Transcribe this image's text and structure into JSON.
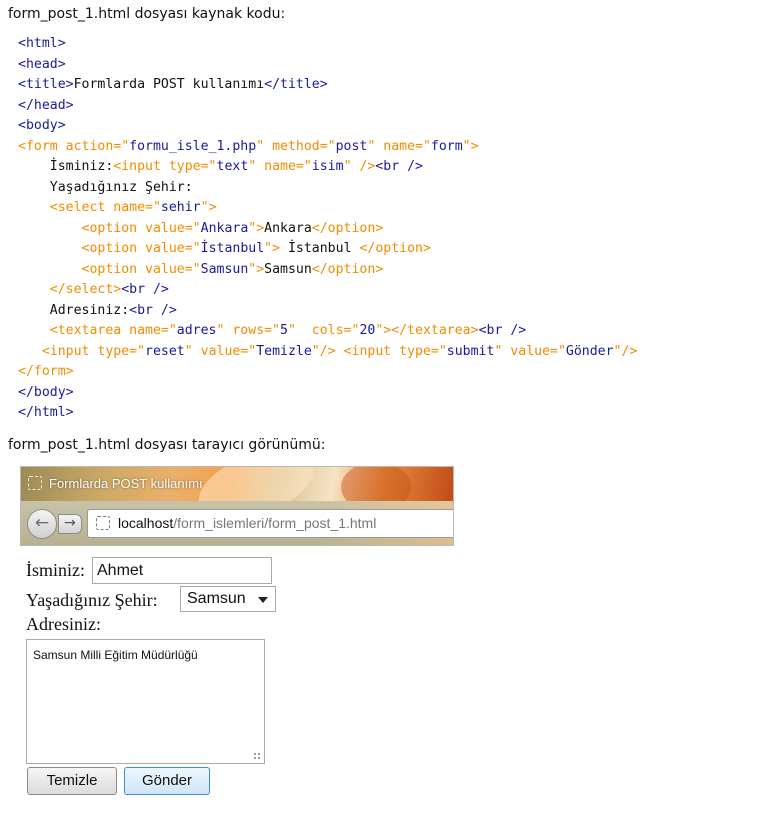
{
  "headings": {
    "source": "form_post_1.html dosyası kaynak kodu:",
    "browser": "form_post_1.html dosyası tarayıcı görünümü:"
  },
  "code_lines": [
    [
      {
        "t": "<html>",
        "c": "tagb"
      }
    ],
    [
      {
        "t": "<head>",
        "c": "tagb"
      }
    ],
    [
      {
        "t": "<title>",
        "c": "tagb"
      },
      {
        "t": "Formlarda POST kullanımı",
        "c": "txt"
      },
      {
        "t": "</title>",
        "c": "tagb"
      }
    ],
    [
      {
        "t": "</head>",
        "c": "tagb"
      }
    ],
    [
      {
        "t": "<body>",
        "c": "tagb"
      }
    ],
    [
      {
        "t": "<form action=\"",
        "c": "tago"
      },
      {
        "t": "formu_isle_1.php",
        "c": "val"
      },
      {
        "t": "\" method=\"",
        "c": "tago"
      },
      {
        "t": "post",
        "c": "val"
      },
      {
        "t": "\" name=\"",
        "c": "tago"
      },
      {
        "t": "form",
        "c": "val"
      },
      {
        "t": "\">",
        "c": "tago"
      }
    ],
    [
      {
        "t": "    İsminiz:",
        "c": "txt"
      },
      {
        "t": "<input type=\"",
        "c": "tago"
      },
      {
        "t": "text",
        "c": "val"
      },
      {
        "t": "\" name=\"",
        "c": "tago"
      },
      {
        "t": "isim",
        "c": "val"
      },
      {
        "t": "\" />",
        "c": "tago"
      },
      {
        "t": "<br />",
        "c": "tagb"
      }
    ],
    [
      {
        "t": "    Yaşadığınız Şehir:",
        "c": "txt"
      }
    ],
    [
      {
        "t": "    <select name=\"",
        "c": "tago"
      },
      {
        "t": "sehir",
        "c": "val"
      },
      {
        "t": "\">",
        "c": "tago"
      }
    ],
    [
      {
        "t": "        <option value=\"",
        "c": "tago"
      },
      {
        "t": "Ankara",
        "c": "val"
      },
      {
        "t": "\">",
        "c": "tago"
      },
      {
        "t": "Ankara",
        "c": "txt"
      },
      {
        "t": "</option>",
        "c": "tago"
      }
    ],
    [
      {
        "t": "        <option value=\"",
        "c": "tago"
      },
      {
        "t": "İstanbul",
        "c": "val"
      },
      {
        "t": "\">",
        "c": "tago"
      },
      {
        "t": " İstanbul ",
        "c": "txt"
      },
      {
        "t": "</option>",
        "c": "tago"
      }
    ],
    [
      {
        "t": "        <option value=\"",
        "c": "tago"
      },
      {
        "t": "Samsun",
        "c": "val"
      },
      {
        "t": "\">",
        "c": "tago"
      },
      {
        "t": "Samsun",
        "c": "txt"
      },
      {
        "t": "</option>",
        "c": "tago"
      }
    ],
    [
      {
        "t": "    </select>",
        "c": "tago"
      },
      {
        "t": "<br />",
        "c": "tagb"
      }
    ],
    [
      {
        "t": "    Adresiniz:",
        "c": "txt"
      },
      {
        "t": "<br />",
        "c": "tagb"
      }
    ],
    [
      {
        "t": "    <textarea name=\"",
        "c": "tago"
      },
      {
        "t": "adres",
        "c": "val"
      },
      {
        "t": "\" rows=\"",
        "c": "tago"
      },
      {
        "t": "5",
        "c": "val"
      },
      {
        "t": "\"  cols=\"",
        "c": "tago"
      },
      {
        "t": "20",
        "c": "val"
      },
      {
        "t": "\"></textarea>",
        "c": "tago"
      },
      {
        "t": "<br />",
        "c": "tagb"
      }
    ],
    [
      {
        "t": "   <input type=\"",
        "c": "tago"
      },
      {
        "t": "reset",
        "c": "val"
      },
      {
        "t": "\" value=\"",
        "c": "tago"
      },
      {
        "t": "Temizle",
        "c": "val"
      },
      {
        "t": "\"/>",
        "c": "tago"
      },
      {
        "t": " ",
        "c": "txt"
      },
      {
        "t": "<input type=\"",
        "c": "tago"
      },
      {
        "t": "submit",
        "c": "val"
      },
      {
        "t": "\" value=\"",
        "c": "tago"
      },
      {
        "t": "Gönder",
        "c": "val"
      },
      {
        "t": "\"/>",
        "c": "tago"
      }
    ],
    [
      {
        "t": "</form>",
        "c": "tago"
      }
    ],
    [
      {
        "t": "</body>",
        "c": "tagb"
      }
    ],
    [
      {
        "t": "</html>",
        "c": "tagb"
      }
    ]
  ],
  "colors": {
    "tag_blue": "#1a1a9a",
    "tag_orange": "#f28c00",
    "focus_blue": "#3c8fd6"
  },
  "browser": {
    "tab_title": "Formlarda POST kullanımı",
    "url_host": "localhost",
    "url_path": "/form_islemleri/form_post_1.html",
    "back_icon": "back-arrow-icon",
    "forward_icon": "forward-arrow-icon",
    "page_icon": "blank-page-icon"
  },
  "form": {
    "isim_label": "İsminiz:",
    "isim_value": "Ahmet",
    "sehir_label": "Yaşadığınız Şehir:",
    "sehir_value": "Samsun",
    "adres_label": "Adresiniz:",
    "adres_value": "Samsun Milli Eğitim Müdürlüğü",
    "reset_label": "Temizle",
    "submit_label": "Gönder"
  }
}
